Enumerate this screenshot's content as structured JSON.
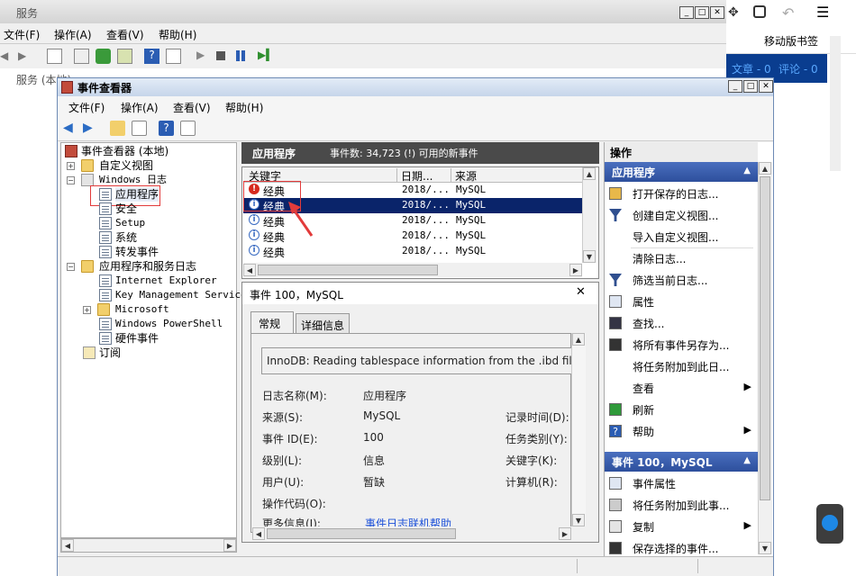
{
  "services_window": {
    "title": "服务",
    "menu": [
      "文件(F)",
      "操作(A)",
      "查看(V)",
      "帮助(H)"
    ],
    "tree_item": "服务 (本地)"
  },
  "browser": {
    "mobile_bookmarks": "移动版书签",
    "article_count": "文章 - 0",
    "comment_count": "评论 - 0"
  },
  "event_viewer": {
    "title": "事件查看器",
    "menu": [
      "文件(F)",
      "操作(A)",
      "查看(V)",
      "帮助(H)"
    ],
    "tree": {
      "root": "事件查看器 (本地)",
      "custom_views": "自定义视图",
      "windows_logs": "Windows 日志",
      "application": "应用程序",
      "security": "安全",
      "setup": "Setup",
      "system": "系统",
      "forwarded": "转发事件",
      "app_service_logs": "应用程序和服务日志",
      "internet_explorer": "Internet Explorer",
      "key_management": "Key Management Service",
      "microsoft": "Microsoft",
      "powershell": "Windows PowerShell",
      "hardware": "硬件事件",
      "subscriptions": "订阅"
    },
    "list_pane": {
      "title": "应用程序",
      "event_count": "事件数: 34,723 (!) 可用的新事件",
      "columns": [
        "关键字",
        "日期...",
        "来源"
      ],
      "rows": [
        {
          "level": "error",
          "keyword": "经典",
          "date": "2018/...",
          "source": "MySQL"
        },
        {
          "level": "info",
          "keyword": "经典",
          "date": "2018/...",
          "source": "MySQL"
        },
        {
          "level": "info",
          "keyword": "经典",
          "date": "2018/...",
          "source": "MySQL"
        },
        {
          "level": "info",
          "keyword": "经典",
          "date": "2018/...",
          "source": "MySQL"
        },
        {
          "level": "info",
          "keyword": "经典",
          "date": "2018/...",
          "source": "MySQL"
        }
      ]
    },
    "detail": {
      "header": "事件 100，MySQL",
      "tabs": [
        "常规",
        "详细信息"
      ],
      "message": "InnoDB: Reading tablespace information from the .ibd file",
      "fields": {
        "log_name_label": "日志名称(M):",
        "log_name_value": "应用程序",
        "source_label": "来源(S):",
        "source_value": "MySQL",
        "event_id_label": "事件 ID(E):",
        "event_id_value": "100",
        "level_label": "级别(L):",
        "level_value": "信息",
        "user_label": "用户(U):",
        "user_value": "暂缺",
        "opcode_label": "操作代码(O):",
        "more_info_label": "更多信息(I):",
        "more_info_link": "事件日志联机帮助",
        "logged_label": "记录时间(D):",
        "task_category_label": "任务类别(Y):",
        "keywords_label": "关键字(K):",
        "computer_label": "计算机(R):"
      }
    },
    "actions": {
      "title": "操作",
      "section1": "应用程序",
      "items1": [
        {
          "label": "打开保存的日志...",
          "icon": "open-folder-icon",
          "submenu": false
        },
        {
          "label": "创建自定义视图...",
          "icon": "filter-icon",
          "submenu": false
        },
        {
          "label": "导入自定义视图...",
          "icon": "",
          "submenu": false
        },
        {
          "label": "清除日志...",
          "icon": "",
          "submenu": false
        },
        {
          "label": "筛选当前日志...",
          "icon": "filter-icon",
          "submenu": false
        },
        {
          "label": "属性",
          "icon": "properties-icon",
          "submenu": false
        },
        {
          "label": "查找...",
          "icon": "binoculars-icon",
          "submenu": false
        },
        {
          "label": "将所有事件另存为...",
          "icon": "save-icon",
          "submenu": false
        },
        {
          "label": "将任务附加到此日...",
          "icon": "",
          "submenu": false
        },
        {
          "label": "查看",
          "icon": "",
          "submenu": true
        },
        {
          "label": "刷新",
          "icon": "refresh-icon",
          "submenu": false
        },
        {
          "label": "帮助",
          "icon": "help-icon",
          "submenu": true
        }
      ],
      "section2": "事件 100，MySQL",
      "items2": [
        {
          "label": "事件属性",
          "icon": "properties-icon",
          "submenu": false
        },
        {
          "label": "将任务附加到此事...",
          "icon": "task-icon",
          "submenu": false
        },
        {
          "label": "复制",
          "icon": "copy-icon",
          "submenu": true
        },
        {
          "label": "保存选择的事件...",
          "icon": "save-icon",
          "submenu": false
        }
      ]
    }
  }
}
